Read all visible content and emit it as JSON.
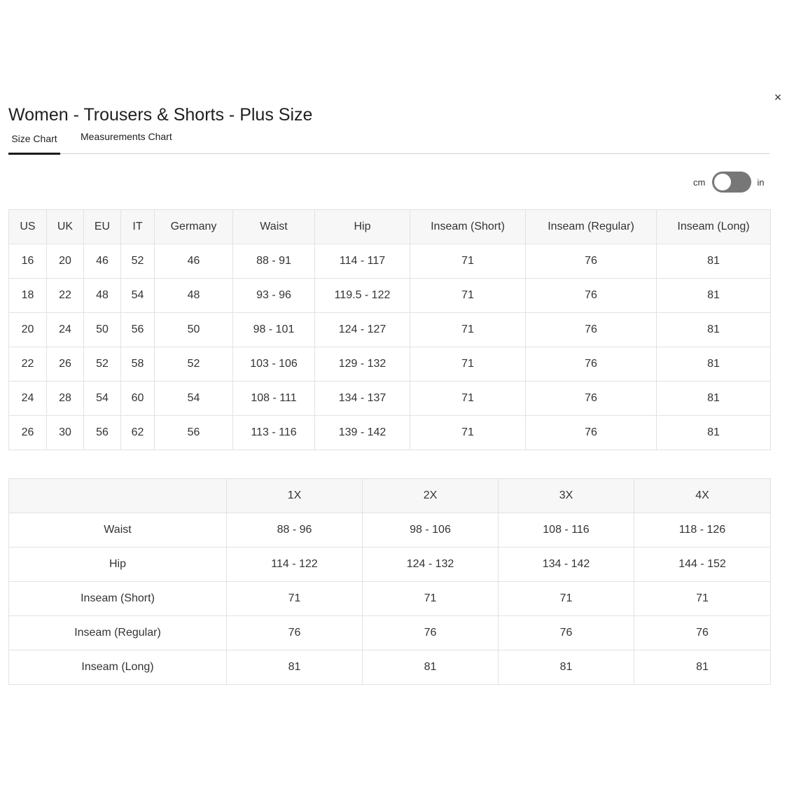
{
  "header": {
    "title": "Women - Trousers & Shorts - Plus Size",
    "close_glyph": "×"
  },
  "tabs": [
    {
      "label": "Size Chart",
      "active": true
    },
    {
      "label": "Measurements Chart",
      "active": false
    }
  ],
  "unit_toggle": {
    "left_label": "cm",
    "right_label": "in",
    "selected": "cm"
  },
  "size_table": {
    "headers": [
      "US",
      "UK",
      "EU",
      "IT",
      "Germany",
      "Waist",
      "Hip",
      "Inseam (Short)",
      "Inseam (Regular)",
      "Inseam (Long)"
    ],
    "rows": [
      [
        "16",
        "20",
        "46",
        "52",
        "46",
        "88 - 91",
        "114 - 117",
        "71",
        "76",
        "81"
      ],
      [
        "18",
        "22",
        "48",
        "54",
        "48",
        "93 - 96",
        "119.5 - 122",
        "71",
        "76",
        "81"
      ],
      [
        "20",
        "24",
        "50",
        "56",
        "50",
        "98 - 101",
        "124 - 127",
        "71",
        "76",
        "81"
      ],
      [
        "22",
        "26",
        "52",
        "58",
        "52",
        "103 - 106",
        "129 - 132",
        "71",
        "76",
        "81"
      ],
      [
        "24",
        "28",
        "54",
        "60",
        "54",
        "108 - 111",
        "134 - 137",
        "71",
        "76",
        "81"
      ],
      [
        "26",
        "30",
        "56",
        "62",
        "56",
        "113 - 116",
        "139 - 142",
        "71",
        "76",
        "81"
      ]
    ]
  },
  "plus_table": {
    "headers": [
      "",
      "1X",
      "2X",
      "3X",
      "4X"
    ],
    "rows": [
      [
        "Waist",
        "88 - 96",
        "98 - 106",
        "108 - 116",
        "118 - 126"
      ],
      [
        "Hip",
        "114 - 122",
        "124 - 132",
        "134 - 142",
        "144 - 152"
      ],
      [
        "Inseam (Short)",
        "71",
        "71",
        "71",
        "71"
      ],
      [
        "Inseam (Regular)",
        "76",
        "76",
        "76",
        "76"
      ],
      [
        "Inseam (Long)",
        "81",
        "81",
        "81",
        "81"
      ]
    ]
  },
  "colors": {
    "text": "#222222",
    "border": "#e2e2e2",
    "header_bg": "#f7f7f7",
    "toggle_track": "#777777",
    "active_tab_underline": "#1a1a1a"
  }
}
